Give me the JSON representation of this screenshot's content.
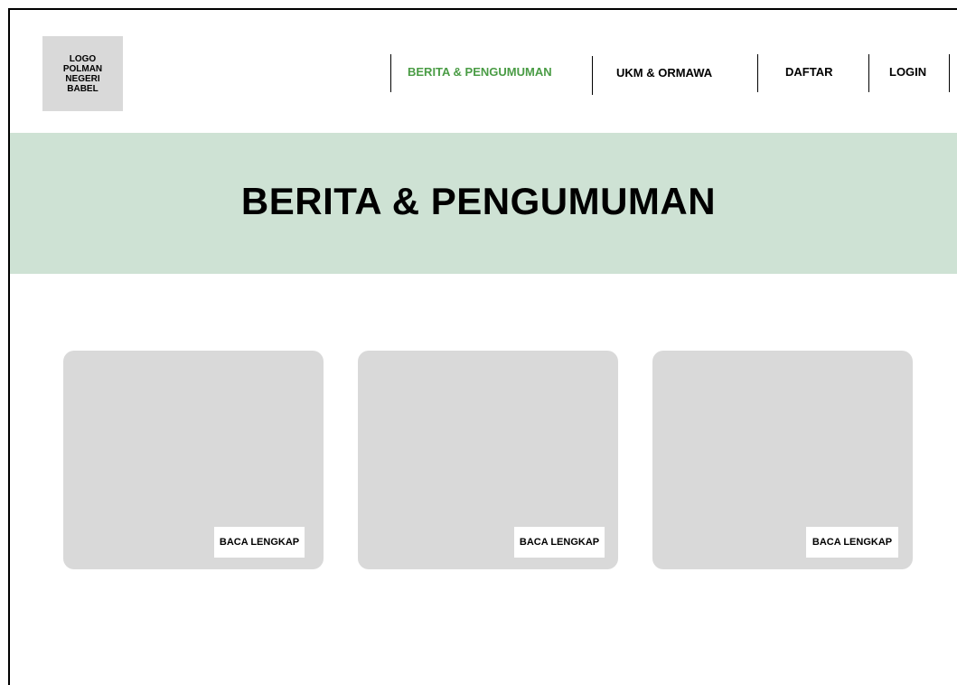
{
  "header": {
    "logo_text": "LOGO\nPOLMAN\nNEGERI\nBABEL",
    "nav": [
      {
        "label": "BERITA & PENGUMUMAN",
        "active": true
      },
      {
        "label": "UKM & ORMAWA",
        "active": false
      },
      {
        "label": "DAFTAR",
        "active": false
      },
      {
        "label": "LOGIN",
        "active": false
      }
    ]
  },
  "hero": {
    "title": "BERITA & PENGUMUMAN"
  },
  "cards": [
    {
      "button_label": "BACA LENGKAP"
    },
    {
      "button_label": "BACA LENGKAP"
    },
    {
      "button_label": "BACA LENGKAP"
    }
  ],
  "colors": {
    "accent": "#4a9c45",
    "hero_background": "#cee2d4",
    "placeholder_gray": "#d9d9d9"
  }
}
